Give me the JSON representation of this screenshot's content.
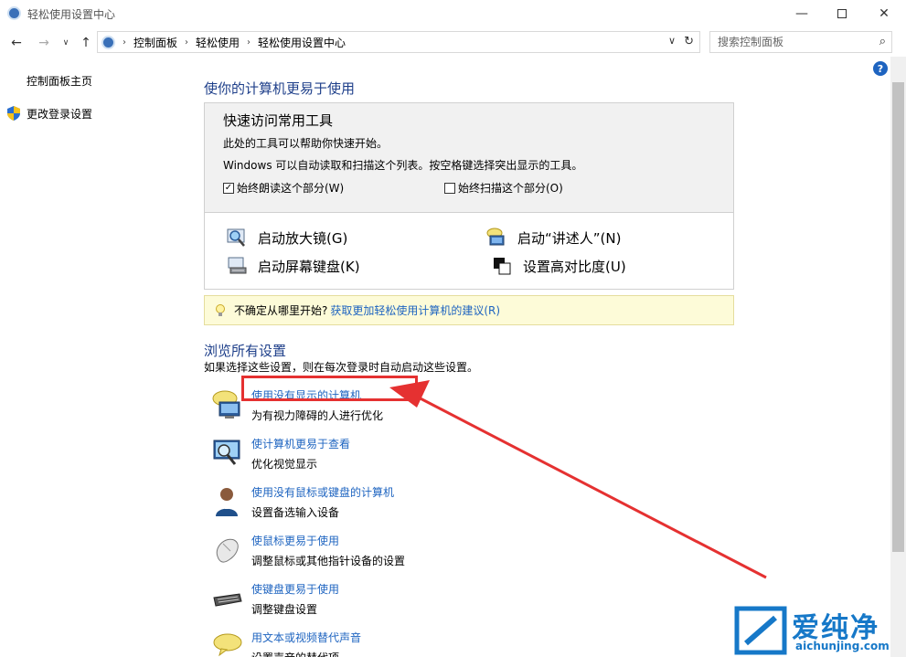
{
  "window": {
    "title": "轻松使用设置中心"
  },
  "nav": {
    "breadcrumbs": [
      "控制面板",
      "轻松使用",
      "轻松使用设置中心"
    ],
    "search_placeholder": "搜索控制面板"
  },
  "sidebar": {
    "items": [
      {
        "label": "控制面板主页"
      },
      {
        "label": "更改登录设置"
      }
    ]
  },
  "main": {
    "heading": "使你的计算机更易于使用",
    "quick": {
      "title": "快速访问常用工具",
      "line1": "此处的工具可以帮助你快速开始。",
      "line2": "Windows 可以自动读取和扫描这个列表。按空格键选择突出显示的工具。",
      "check1": {
        "label": "始终朗读这个部分(W)",
        "checked": true
      },
      "check2": {
        "label": "始终扫描这个部分(O)",
        "checked": false
      },
      "tools": [
        {
          "label": "启动放大镜(G)",
          "icon": "magnifier-icon"
        },
        {
          "label": "启动“讲述人”(N)",
          "icon": "narrator-icon"
        },
        {
          "label": "启动屏幕键盘(K)",
          "icon": "onscreen-keyboard-icon"
        },
        {
          "label": "设置高对比度(U)",
          "icon": "high-contrast-icon"
        }
      ]
    },
    "tip": {
      "prefix": "不确定从哪里开始?",
      "link": "获取更加轻松使用计算机的建议(R)"
    },
    "browse": {
      "heading": "浏览所有设置",
      "subtitle": "如果选择这些设置，则在每次登录时自动启动这些设置。",
      "items": [
        {
          "link": "使用没有显示的计算机",
          "desc": "为有视力障碍的人进行优化",
          "icon": "speech-bubble-monitor-icon"
        },
        {
          "link": "使计算机更易于查看",
          "desc": "优化视觉显示",
          "icon": "magnify-monitor-icon"
        },
        {
          "link": "使用没有鼠标或键盘的计算机",
          "desc": "设置备选输入设备",
          "icon": "user-icon"
        },
        {
          "link": "使鼠标更易于使用",
          "desc": "调整鼠标或其他指针设备的设置",
          "icon": "mouse-icon"
        },
        {
          "link": "使键盘更易于使用",
          "desc": "调整键盘设置",
          "icon": "keyboard-icon"
        },
        {
          "link": "用文本或视频替代声音",
          "desc": "设置声音的替代项",
          "icon": "speech-bubble-icon"
        }
      ]
    }
  },
  "watermark": {
    "cn": "爱纯净",
    "en": "aichunjing.com"
  },
  "colors": {
    "link": "#1e64c0",
    "heading": "#1e3f8a",
    "annotation": "#e53131",
    "watermark": "#1678c8"
  }
}
